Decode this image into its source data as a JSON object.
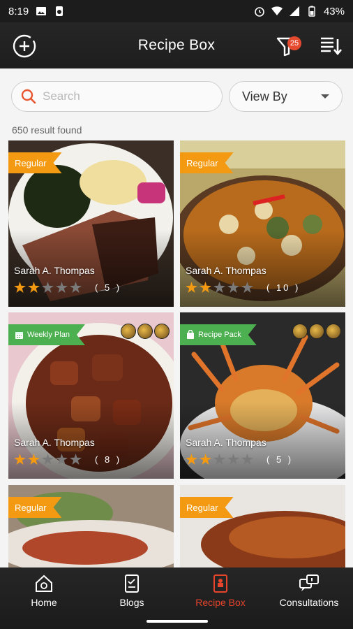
{
  "status_bar": {
    "time": "8:19",
    "battery": "43%"
  },
  "header": {
    "title": "Recipe Box",
    "filter_count": "25"
  },
  "search": {
    "placeholder": "Search",
    "value": ""
  },
  "view_by": {
    "label": "View By"
  },
  "results": {
    "count_text": "650 result found"
  },
  "recipes": [
    {
      "tag": "Regular",
      "author": "Sarah A. Thompas",
      "rating": 2,
      "reviews": "( 5 )"
    },
    {
      "tag": "Regular",
      "author": "Sarah A. Thompas",
      "rating": 2,
      "reviews": "( 10 )"
    },
    {
      "tag": "Weekly Plan",
      "author": "Sarah A. Thompas",
      "rating": 2,
      "reviews": "( 8 )"
    },
    {
      "tag": "Recipe Pack",
      "author": "Sarah A. Thompas",
      "rating": 2,
      "reviews": "( 5 )"
    },
    {
      "tag": "Regular"
    },
    {
      "tag": "Regular"
    }
  ],
  "bottom_nav": {
    "items": [
      {
        "label": "Home"
      },
      {
        "label": "Blogs"
      },
      {
        "label": "Recipe Box"
      },
      {
        "label": "Consultations"
      }
    ],
    "active_index": 2
  },
  "colors": {
    "accent": "#f39a12",
    "active_nav": "#e6452c",
    "tag_green": "#4caf50",
    "search_icon": "#e8552f"
  }
}
